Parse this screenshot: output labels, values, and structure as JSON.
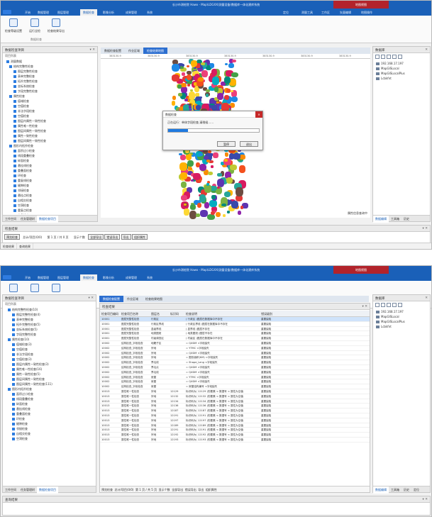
{
  "top": {
    "titlebar": {
      "window_title": "长沙市测绘院 Hawx - Map\\LDGXX(测量设备)数据库一体化建库系统",
      "context_tab": "地图视图"
    },
    "menu": [
      "开始",
      "数据管理",
      "图层管理",
      "数据检查",
      "影像分析",
      "成果管理",
      "系统",
      "定位",
      "测量工具",
      "工作区",
      "矢量编辑",
      "地图操作"
    ],
    "ribbon": {
      "buttons": [
        "检查等级设置",
        "运行全检",
        "检查结果导出"
      ],
      "group": "数据检查"
    },
    "left_panel": {
      "title": "数据检查项目",
      "subheader": "项目列表",
      "tree": [
        "测量数据",
        "结构完整性检查",
        "图层完整性检查",
        "表单完整检查",
        "拓扑完整性检查",
        "坐标系统检查",
        "字段完整性检查",
        "属性检查",
        "值域检查",
        "空值检查",
        "非法字段检查",
        "空值检查",
        "图层内属性一致性检查",
        "属性唯一性检查",
        "图层间属性一致性检查",
        "属性一致性检查",
        "图层间属性一致性检查",
        "图形内拓扑检查",
        "面积过小检查",
        "线段重叠检查",
        "碎面检查",
        "悬挂线检查",
        "重叠面检查",
        "环检查",
        "重复线检查",
        "缝隙检查",
        "邻接检查",
        "悬挂点检查",
        "自相交检查",
        "空洞检查",
        "重复点检查",
        "尖角检查"
      ],
      "tabs": [
        "工作空间",
        "任务管理树",
        "数据检查项目"
      ]
    },
    "doc_tabs": [
      "数据检查配置",
      "作业区域",
      "检查结果地图"
    ],
    "ruler_ticks": [
      "383130.9",
      "383130.9",
      "383130.9",
      "383130.9",
      "383130.9",
      "383130.9",
      "383130.9"
    ],
    "dialog": {
      "title": "数据检查",
      "message": "正在运行：单体字段检查,请稍候……",
      "progress_pct": 22,
      "ok": "暂停",
      "cancel": "退出"
    },
    "map_status": "属性信息查询中",
    "right_panel": {
      "title": "数据库",
      "servers": [
        "192.168.17.197",
        "MapGISLocal",
        "MapGISLocalPlus",
        "Lcbkfnt"
      ],
      "tabs": [
        "数据编辑",
        "工具箱",
        "历史"
      ]
    },
    "bottom_panel": {
      "title": "检查结果",
      "buttons": [
        "预览检查",
        "总计/项目(0/0)",
        "第 1 页 / 共 0 页",
        "显示个数",
        "全部导出",
        "错误导出",
        "导出",
        "组织属性"
      ]
    },
    "status_tabs": [
      "检查结果",
      "查询结果"
    ]
  },
  "bottom": {
    "titlebar": {
      "window_title": "长沙市测绘院 Hawx - Map\\LDGXX(测量设备)数据库一体化建库系统",
      "context_tab": "地图视图"
    },
    "menu": [
      "开始",
      "数据管理",
      "图层管理",
      "数据检查",
      "影像分析",
      "成果管理",
      "系统"
    ],
    "ribbon": {
      "buttons": [
        "检查等级设置",
        "运行全检",
        "检查结果导出"
      ],
      "group": "数据检查"
    },
    "left_panel": {
      "title": "数据检查项目",
      "subheader": "项目列表",
      "tree": [
        "结构完整性检查(10)",
        "图层完整性检查(4)",
        "表单完整检查",
        "拓扑完整性检查(5)",
        "坐标系统检查(5)",
        "字段完整性检查",
        "属性检查(10)",
        "值域检查(3)",
        "空值检查",
        "非法字段检查",
        "空值检查(3)",
        "图层内属性一致性检查(3)",
        "属性唯一性检查(16)",
        "属性一致性检查(5)",
        "图层间属性一致性检查",
        "图层间属性一致性检查(111)",
        "图形内拓扑检查",
        "面积过小检查",
        "线段重叠检查",
        "碎面检查",
        "悬挂线检查",
        "重叠面检查",
        "环检查",
        "缝隙检查",
        "邻接检查",
        "自相交检查",
        "空洞检查"
      ],
      "tabs": [
        "工作空间",
        "任务管理树",
        "数据检查项目"
      ]
    },
    "doc_tabs": [
      "数据检查配置",
      "作业区域",
      "检查结果地图"
    ],
    "result": {
      "title": "检查结果",
      "columns": [
        "检查项目编码",
        "检查项目名称",
        "图层名",
        "标识码",
        "检查说明",
        "错误级别"
      ],
      "rows": [
        [
          "10001",
          "图层完整性检查",
          "行政区",
          "",
          "( 行政区 )图层在数据库中不存在",
          "重要缺陷"
        ],
        [
          "10001",
          "图层完整性检查",
          "行政区界线",
          "",
          "( 行政区界线 )图层在数据库中不存在",
          "重要缺陷"
        ],
        [
          "10001",
          "图层完整性检查",
          "县级界线",
          "",
          "( 县界线 )图层不存在",
          "重要缺陷"
        ],
        [
          "10001",
          "图层完整性检查",
          "地类图斑",
          "",
          "( 地类图斑 )图层不存在",
          "重要缺陷"
        ],
        [
          "10001",
          "图层完整性检查",
          "村级调查区",
          "",
          "( 村级区 )图层在数据库中不存在",
          "重要缺陷"
        ],
        [
          "10002",
          "结构检查_字段检查",
          "地籍子区",
          "",
          "= QXDM <字段缺失",
          "重要缺陷"
        ],
        [
          "10002",
          "结构检查_字段检查",
          "宗地",
          "",
          "= YTMC <字段缺失",
          "重要缺陷"
        ],
        [
          "10002",
          "结构检查_字段检查",
          "宗地",
          "",
          "= QXDM <字段缺失",
          "重要缺陷"
        ],
        [
          "10002",
          "结构检查_字段检查",
          "宗地",
          "",
          "= 图形面积(KM) <字段缺失",
          "重要缺陷"
        ],
        [
          "10002",
          "结构检查_字段检查",
          "界址线",
          "",
          "= Shape_Leng <字段缺失",
          "重要缺陷"
        ],
        [
          "10002",
          "结构检查_字段检查",
          "界址点",
          "",
          "= QXDM <字段缺失",
          "重要缺陷"
        ],
        [
          "10002",
          "结构检查_字段检查",
          "界址线",
          "",
          "= QXDM <字段缺失",
          "重要缺陷"
        ],
        [
          "10002",
          "结构检查_字段检查",
          "房屋",
          "",
          "= YTMC <字段缺失",
          "重要缺陷"
        ],
        [
          "10002",
          "结构检查_字段检查",
          "房屋",
          "",
          "= QXDM <字段缺失",
          "重要缺陷"
        ],
        [
          "10002",
          "结构检查_字段检查",
          "房屋",
          "",
          "= 房屋结构编号 <字段缺失",
          "重要缺陷"
        ],
        [
          "10013",
          "属性唯一性检查",
          "宗地",
          "12129",
          "标识码为( 12129 )的要素 < 数据号 < 属性为空值",
          "重要缺陷"
        ],
        [
          "10013",
          "属性唯一性检查",
          "宗地",
          "12132",
          "标识码为( 12132 )的要素 < 数据号 < 属性为空值",
          "重要缺陷"
        ],
        [
          "10013",
          "属性唯一性检查",
          "宗地",
          "12134",
          "标识码为( 12134 )的要素 < 数据号 < 属性为空值",
          "重要缺陷"
        ],
        [
          "10013",
          "属性唯一性检查",
          "宗地",
          "12136",
          "标识码为( 12136 )的要素 < 数据号 < 属性为空值",
          "重要缺陷"
        ],
        [
          "10013",
          "属性唯一性检查",
          "宗地",
          "12187",
          "标识码为( 12187 )的要素 < 数据号 < 属性为空值",
          "重要缺陷"
        ],
        [
          "10013",
          "属性唯一性检查",
          "宗地",
          "12191",
          "标识码为( 12191 )的要素 < 数据号 < 属性为空值",
          "重要缺陷"
        ],
        [
          "10013",
          "属性唯一性检查",
          "宗地",
          "12197",
          "标识码为( 12197 )的要素 < 数据号 < 属性为空值",
          "重要缺陷"
        ],
        [
          "10013",
          "属性唯一性检查",
          "宗地",
          "12189",
          "标识码为( 12189 )的要素 < 数据号 < 属性为空值",
          "重要缺陷"
        ],
        [
          "10013",
          "属性唯一性检查",
          "宗地",
          "12191",
          "标识码为( 12191 )的要素 < 数据号 < 属性为空值",
          "重要缺陷"
        ],
        [
          "10013",
          "属性唯一性检查",
          "宗地",
          "12192",
          "标识码为( 12192 )的要素 < 数据号 < 属性为空值",
          "重要缺陷"
        ],
        [
          "10013",
          "属性唯一性检查",
          "宗地",
          "12193",
          "标识码为( 12193 )的要素 < 数据号 < 属性为空值",
          "重要缺陷"
        ]
      ]
    },
    "right_panel": {
      "title": "数据库",
      "servers": [
        "192.168.17.197",
        "MapGISLocal",
        "MapGISLocalPlus",
        "Lcbkfnt"
      ],
      "tabs": [
        "数据编辑",
        "工具箱",
        "历史",
        "定位"
      ]
    },
    "pager": {
      "buttons": [
        "预览检查",
        "总计/项目(0/0)",
        "第 1 页 / 共 5 页",
        "显示个数",
        "全部导出",
        "错误导出",
        "导出",
        "组织属性"
      ]
    },
    "bottom_panel": {
      "title": "查询结果"
    }
  },
  "colors": {
    "titlebar": "#1a60b8",
    "context": "#b2232b",
    "progress": "#1f7ae0"
  }
}
